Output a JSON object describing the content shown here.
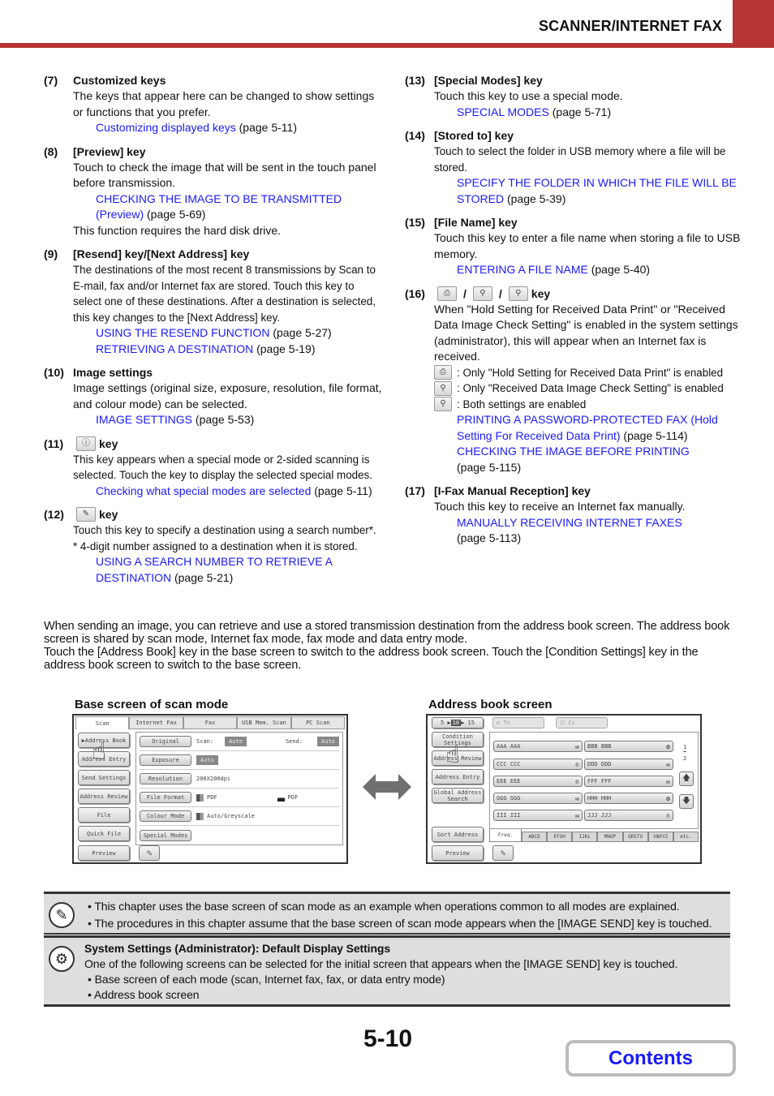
{
  "header": {
    "section_title": "SCANNER/INTERNET FAX",
    "accent_color": "#b63434"
  },
  "left_items": [
    {
      "num": "(7)",
      "title": "Customized keys",
      "body": [
        "The keys that appear here can be changed to show settings or functions that you prefer."
      ],
      "refs": [
        {
          "link": "Customizing displayed keys",
          "page": " (page 5-11)"
        }
      ],
      "after": ""
    },
    {
      "num": "(8)",
      "title": "[Preview] key",
      "body": [
        "Touch to check the image that will be sent in the touch panel before transmission."
      ],
      "refs": [
        {
          "link": "CHECKING THE IMAGE TO BE TRANSMITTED (Preview)",
          "page": " (page 5-69)"
        }
      ],
      "after": "This function requires the hard disk drive."
    },
    {
      "num": "(9)",
      "title": "[Resend] key/[Next Address] key",
      "body": [
        "The destinations of the most recent 8 transmissions by Scan to E-mail, fax and/or Internet fax are stored. Touch this key to select one of these destinations. After a destination is selected, this key changes to the [Next Address] key."
      ],
      "refs": [
        {
          "link": "USING THE RESEND FUNCTION",
          "page": " (page 5-27)"
        },
        {
          "link": "RETRIEVING A DESTINATION",
          "page": " (page 5-19)"
        }
      ],
      "after": ""
    },
    {
      "num": "(10)",
      "title": "Image settings",
      "body": [
        "Image settings (original size, exposure, resolution, file format, and colour mode) can be selected."
      ],
      "refs": [
        {
          "link": "IMAGE SETTINGS",
          "page": " (page 5-53)"
        }
      ],
      "after": ""
    },
    {
      "num": "(11)",
      "title": "key",
      "icon": "special-modes-info-icon",
      "body": [
        "This key appears when a special mode or 2-sided scanning is selected. Touch the key to display the selected special modes."
      ],
      "refs": [
        {
          "link": "Checking what special modes are selected",
          "page": " (page 5-11)"
        }
      ],
      "after": ""
    },
    {
      "num": "(12)",
      "title": "key",
      "icon": "search-number-icon",
      "body": [
        "Touch this key to specify a destination using a search number*.",
        "* 4-digit number assigned to a destination when it is stored."
      ],
      "refs": [
        {
          "link": "USING A SEARCH NUMBER TO RETRIEVE A DESTINATION",
          "page": " (page 5-21)"
        }
      ],
      "after": ""
    }
  ],
  "right_items": [
    {
      "num": "(13)",
      "title": "[Special Modes] key",
      "body": [
        "Touch this key to use a special mode."
      ],
      "refs": [
        {
          "link": "SPECIAL MODES",
          "page": " (page 5-71)"
        }
      ]
    },
    {
      "num": "(14)",
      "title": "[Stored to] key",
      "body": [
        "Touch to select the folder in USB memory where a file will be stored."
      ],
      "refs": [
        {
          "link": "SPECIFY THE FOLDER IN WHICH THE FILE WILL BE STORED",
          "page": " (page 5-39)"
        }
      ]
    },
    {
      "num": "(15)",
      "title": "[File Name] key",
      "body": [
        "Touch this key to enter a file name when storing a file to USB memory."
      ],
      "refs": [
        {
          "link": "ENTERING A FILE NAME",
          "page": " (page 5-40)"
        }
      ]
    },
    {
      "num": "(16)",
      "title": "key",
      "slash": "/",
      "body": [
        "When \"Hold Setting for Received Data Print\" or \"Received Data Image Check Setting\" is enabled in the system settings (administrator), this will appear when an Internet fax is received."
      ],
      "legend": [
        {
          "icon": "hold-print-icon",
          "text": ":  Only \"Hold Setting for Received Data Print\" is enabled"
        },
        {
          "icon": "image-check-icon",
          "text": ":  Only \"Received Data Image Check Setting\" is enabled"
        },
        {
          "icon": "both-settings-icon",
          "text": ":  Both settings are enabled"
        }
      ],
      "refs": [
        {
          "link": "PRINTING A PASSWORD-PROTECTED FAX (Hold Setting For Received Data Print)",
          "page": " (page 5-114)"
        },
        {
          "link": "CHECKING THE IMAGE BEFORE PRINTING",
          "page": " (page 5-115)"
        }
      ]
    },
    {
      "num": "(17)",
      "title": "[I-Fax Manual Reception] key",
      "body": [
        "Touch this key to receive an Internet fax manually."
      ],
      "refs": [
        {
          "link": "MANUALLY RECEIVING INTERNET FAXES",
          "page": " (page 5-113)"
        }
      ]
    }
  ],
  "intro": {
    "p1": "When sending an image, you can retrieve and use a stored transmission destination from the address book screen. The address book screen is shared by scan mode, Internet fax mode, fax mode and data entry mode.",
    "p2": "Touch the [Address Book] key in the base screen to switch to the address book screen. Touch the [Condition Settings] key in the address book screen to switch to the base screen."
  },
  "base_screen": {
    "caption": "Base screen of scan mode",
    "tabs": [
      "Scan",
      "Internet Fax",
      "Fax",
      "USB Mem. Scan",
      "PC Scan"
    ],
    "side_buttons": [
      "▶Address Book",
      "Address Entry",
      "Send Settings",
      "Address Review",
      "File",
      "Quick File",
      "Preview"
    ],
    "rows": [
      {
        "button": "Original",
        "scan_label": "Scan:",
        "scan_value": "Auto",
        "send_label": "Send:",
        "send_value": "Auto"
      },
      {
        "button": "Exposure",
        "value": "Auto"
      },
      {
        "button": "Resolution",
        "value": "200X200dpi"
      },
      {
        "button": "File Format",
        "value1": "PDF",
        "value2": "PDF"
      },
      {
        "button": "Colour Mode",
        "value": "Auto/Greyscale"
      },
      {
        "button": "Special Modes"
      }
    ]
  },
  "address_screen": {
    "caption": "Address book screen",
    "display_count": {
      "options": [
        "5",
        "10",
        "15"
      ],
      "selected": "10"
    },
    "to_label": "To",
    "cc_label": "Cc",
    "side_buttons": [
      "Condition Settings",
      "Address Review",
      "Address Entry",
      "Global Address Search",
      "Sort Address",
      "Preview"
    ],
    "entries": [
      {
        "name": "AAA AAA",
        "type": "email"
      },
      {
        "name": "BBB BBB",
        "type": "group"
      },
      {
        "name": "CCC CCC",
        "type": "fax"
      },
      {
        "name": "DDD DDD",
        "type": "email"
      },
      {
        "name": "EEE EEE",
        "type": "fax"
      },
      {
        "name": "FFF FFF",
        "type": "email"
      },
      {
        "name": "GGG GGG",
        "type": "email"
      },
      {
        "name": "HHH HHH",
        "type": "ifax"
      },
      {
        "name": "III III",
        "type": "email"
      },
      {
        "name": "JJJ JJJ",
        "type": "fax"
      }
    ],
    "page_current": "1",
    "page_total": "2",
    "index_tabs": [
      "Freq.",
      "ABCD",
      "EFGH",
      "IJKL",
      "MNOP",
      "QRSTU",
      "VWXYZ",
      "etc."
    ]
  },
  "notes": {
    "info_bullets": [
      "• This chapter uses the base screen of scan mode as an example when operations common to all modes are explained.",
      "• The procedures in this chapter assume that the base screen of scan mode appears when the [IMAGE SEND] key is touched."
    ],
    "settings_title": "System Settings (Administrator): Default Display Settings",
    "settings_text": "One of the following screens can be selected for the initial screen that appears when the [IMAGE SEND] key is touched.",
    "settings_bullets": [
      "• Base screen of each mode (scan, Internet fax, fax, or data entry mode)",
      "• Address book screen"
    ]
  },
  "footer": {
    "page_number": "5-10",
    "contents_label": "Contents"
  }
}
